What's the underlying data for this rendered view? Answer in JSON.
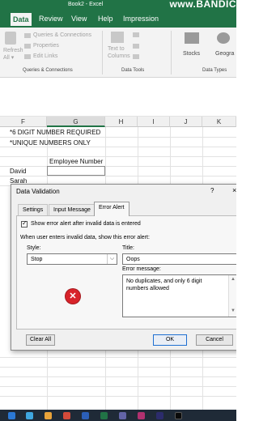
{
  "window": {
    "title": "Book2 - Excel",
    "watermark": "www.BANDIC"
  },
  "menu": {
    "tabs": [
      "Data",
      "Review",
      "View",
      "Help",
      "Impression"
    ],
    "active": "Data"
  },
  "ribbon": {
    "refresh_all": "Refresh All ▾",
    "queries_connections": "Queries & Connections",
    "properties": "Properties",
    "edit_links": "Edit Links",
    "text_to_columns": "Text to Columns",
    "stocks": "Stocks",
    "geography": "Geogra",
    "groups": [
      "Queries & Connections",
      "Data Tools",
      "Data Types"
    ]
  },
  "sheet": {
    "columns": [
      "F",
      "G",
      "H",
      "I",
      "J",
      "K"
    ],
    "selected_column": "G",
    "cells": {
      "note1": "*6 DIGIT NUMBER REQUIRED",
      "note2": "*UNIQUE NUMBERS ONLY",
      "header": "Employee Number",
      "name1": "David",
      "name2": "Sarah"
    }
  },
  "dialog": {
    "title": "Data Validation",
    "help": "?",
    "close": "×",
    "tabs": [
      "Settings",
      "Input Message",
      "Error Alert"
    ],
    "active_tab": "Error Alert",
    "show_alert_label": "Show error alert after invalid data is entered",
    "show_alert_checked": true,
    "instruction": "When user enters invalid data, show this error alert:",
    "style_label": "Style:",
    "style_value": "Stop",
    "title_label": "Title:",
    "title_value": "Oops",
    "message_label": "Error message:",
    "message_value": "No duplicates, and only 6 digit numbers allowed",
    "clear_all": "Clear All",
    "ok": "OK",
    "cancel": "Cancel",
    "icon": "error-stop-icon"
  },
  "colors": {
    "excel_green": "#217346",
    "error_red": "#d8232a"
  }
}
